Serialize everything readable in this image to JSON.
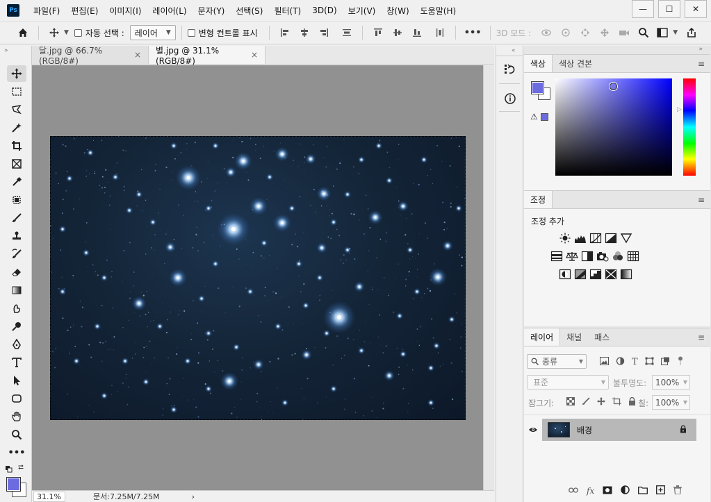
{
  "app": {
    "logo": "Ps"
  },
  "menu": [
    "파일(F)",
    "편집(E)",
    "이미지(I)",
    "레이어(L)",
    "문자(Y)",
    "선택(S)",
    "필터(T)",
    "3D(D)",
    "보기(V)",
    "창(W)",
    "도움말(H)"
  ],
  "window_controls": {
    "minimize": "—",
    "maximize": "☐",
    "close": "✕"
  },
  "options": {
    "auto_select_label": "자동 선택 :",
    "auto_select_target": "레이어",
    "transform_label": "변형 컨트롤 표시",
    "more_label": "•••",
    "mode_3d_label": "3D 모드 :"
  },
  "tabs": [
    {
      "label": "달.jpg @ 66.7% (RGB/8#)",
      "close": "×",
      "active": false
    },
    {
      "label": "별.jpg @ 31.1% (RGB/8#)",
      "close": "×",
      "active": true
    }
  ],
  "status": {
    "zoom": "31.1%",
    "doc": "문서:7.25M/7.25M",
    "arrow": "›"
  },
  "colors": {
    "foreground": "#6c6ce0",
    "background": "#ffffff",
    "picker_hue": "#0000ff"
  },
  "color_panel": {
    "tabs": [
      "색상",
      "색상 견본"
    ]
  },
  "adjust_panel": {
    "tab": "조정",
    "add_label": "조정 추가"
  },
  "layers_panel": {
    "tabs": [
      "레이어",
      "채널",
      "패스"
    ],
    "filter_label": "종류",
    "blend_mode": "표준",
    "opacity_label": "불투명도:",
    "opacity_value": "100%",
    "lock_label": "잠그기:",
    "fill_label": "칠:",
    "fill_value": "100%",
    "layers": [
      {
        "name": "배경",
        "locked": true,
        "visible": true
      }
    ]
  },
  "stars": [
    [
      271,
      256,
      7
    ],
    [
      336,
      330,
      9
    ],
    [
      488,
      457,
      9
    ],
    [
      372,
      297,
      5
    ],
    [
      406,
      321,
      5
    ],
    [
      350,
      232,
      5
    ],
    [
      406,
      222,
      4
    ],
    [
      256,
      400,
      5
    ],
    [
      630,
      399,
      5
    ],
    [
      200,
      437,
      4
    ],
    [
      466,
      279,
      4
    ],
    [
      540,
      313,
      4
    ],
    [
      580,
      297,
      3
    ],
    [
      644,
      354,
      3
    ],
    [
      330,
      549,
      5
    ],
    [
      245,
      356,
      3
    ],
    [
      447,
      229,
      3
    ],
    [
      517,
      413,
      3
    ],
    [
      372,
      525,
      3
    ],
    [
      463,
      357,
      3
    ],
    [
      441,
      511,
      3
    ],
    [
      388,
      255,
      2
    ],
    [
      332,
      248,
      3
    ],
    [
      300,
      300,
      2
    ],
    [
      186,
      303,
      2
    ],
    [
      124,
      364,
      2
    ],
    [
      100,
      257,
      2
    ],
    [
      166,
      255,
      2
    ],
    [
      610,
      230,
      2
    ],
    [
      560,
      541,
      3
    ],
    [
      575,
      455,
      2
    ],
    [
      628,
      498,
      2
    ],
    [
      150,
      570,
      2
    ],
    [
      250,
      590,
      2
    ],
    [
      410,
      580,
      2
    ],
    [
      480,
      560,
      2
    ],
    [
      520,
      505,
      2
    ],
    [
      300,
      480,
      2
    ],
    [
      230,
      470,
      2
    ],
    [
      180,
      520,
      2
    ],
    [
      140,
      470,
      2
    ],
    [
      90,
      420,
      2
    ],
    [
      110,
      520,
      2
    ],
    [
      620,
      580,
      2
    ],
    [
      660,
      300,
      2
    ],
    [
      650,
      460,
      2
    ],
    [
      520,
      230,
      2
    ],
    [
      560,
      260,
      2
    ],
    [
      480,
      320,
      2
    ],
    [
      430,
      380,
      2
    ],
    [
      360,
      420,
      2
    ],
    [
      290,
      430,
      2
    ],
    [
      310,
      380,
      2
    ],
    [
      400,
      470,
      2
    ],
    [
      440,
      440,
      2
    ],
    [
      270,
      520,
      2
    ],
    [
      340,
      500,
      2
    ],
    [
      220,
      320,
      2
    ],
    [
      200,
      280,
      2
    ],
    [
      130,
      220,
      2
    ],
    [
      90,
      330,
      2
    ],
    [
      460,
      400,
      2
    ],
    [
      600,
      420,
      2
    ],
    [
      590,
      360,
      2
    ],
    [
      500,
      360,
      2
    ],
    [
      420,
      300,
      2
    ],
    [
      380,
      350,
      2
    ],
    [
      500,
      280,
      2
    ],
    [
      545,
      210,
      2
    ],
    [
      250,
      210,
      2
    ],
    [
      310,
      210,
      2
    ],
    [
      470,
      480,
      2
    ],
    [
      300,
      560,
      2
    ],
    [
      210,
      550,
      2
    ],
    [
      620,
      530,
      2
    ],
    [
      580,
      510,
      2
    ],
    [
      150,
      400,
      2
    ]
  ]
}
